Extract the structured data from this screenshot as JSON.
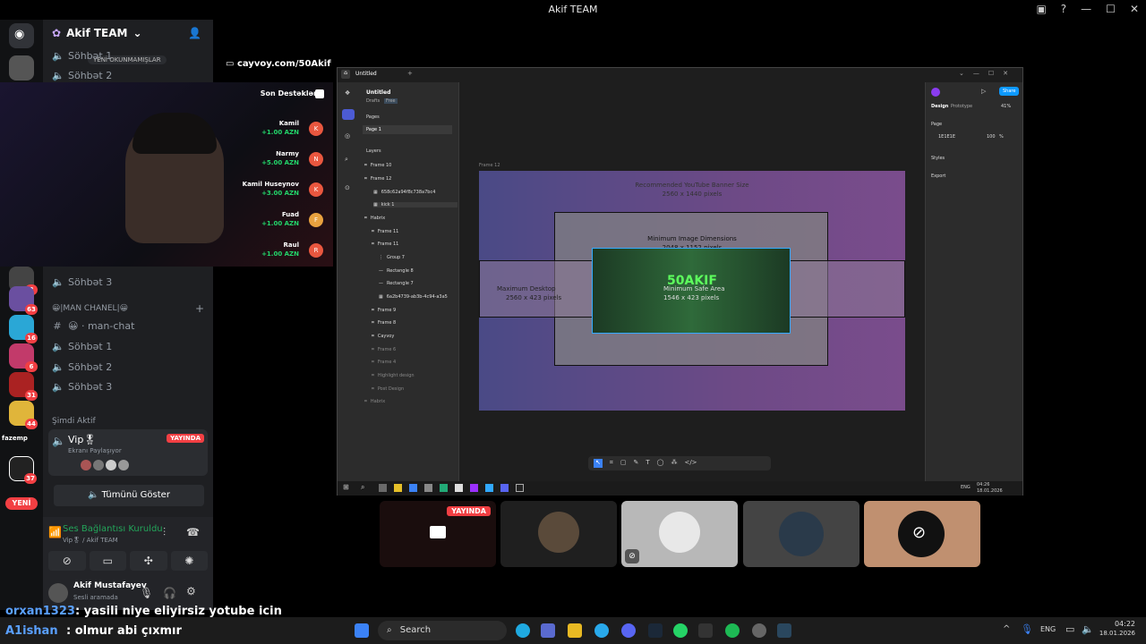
{
  "window": {
    "title": "Akif TEAM"
  },
  "server": {
    "name": "Akif TEAM",
    "new_unread": "YENİ OKUNMAMIŞLAR"
  },
  "channels_top": [
    "Söhbət 1",
    "Söhbət 2",
    "Söhbət 3"
  ],
  "category": {
    "name": "😀|MAN CHANEL|😀"
  },
  "channels_cat": {
    "text": "😀 · man-chat",
    "voice": [
      "Söhbət 1",
      "Söhbət 2",
      "Söhbət 3"
    ]
  },
  "active": {
    "heading": "Şimdi Aktif",
    "channel": "Vip🎖",
    "sub": "Ekranı Paylaşıyor",
    "live": "YAYINDA",
    "show_all": "Tümünü Göster"
  },
  "voice_status": {
    "title": "Ses Bağlantısı Kuruldu",
    "sub": "Vip🎖 / Akif TEAM"
  },
  "user": {
    "name": "Akif Mustafayev",
    "status": "Sesli aramada"
  },
  "rail_badges": [
    "3",
    "63",
    "16",
    "6",
    "31",
    "44",
    "37"
  ],
  "rail_new": "YENİ",
  "rail_label": "fazemp",
  "overlay": {
    "link": "cayvoy.com/50Akif",
    "donors_title": "Son Destəklər",
    "donors": [
      {
        "name": "Kamil",
        "amount": "+1.00 AZN"
      },
      {
        "name": "Narmy",
        "amount": "+5.00 AZN"
      },
      {
        "name": "Kamil Huseynov",
        "amount": "+3.00 AZN"
      },
      {
        "name": "Fuad",
        "amount": "+1.00 AZN"
      },
      {
        "name": "Raul",
        "amount": "+1.00 AZN"
      }
    ]
  },
  "figma": {
    "tab": "Untitled",
    "file": "Untitled",
    "drafts": "Drafts",
    "plan": "Free",
    "pages_label": "Pages",
    "page1": "Page 1",
    "layers_label": "Layers",
    "layers": [
      "Frame 10",
      "Frame 12",
      "658c62a94f8c738a7bc4",
      "kick 1",
      "Habrix",
      "Frame 11",
      "Frame 11",
      "Group 7",
      "Rectangle 8",
      "Rectangle 7",
      "6a2b4739-ab3b-4c94-a3a5",
      "Frame 9",
      "Frame 8",
      "Cayvoy",
      "Frame 6",
      "Frame 4",
      "Highlight design",
      "Post Design",
      "Habrix"
    ],
    "frame_label": "Frame 12",
    "banner": {
      "rec_title": "Recommended YouTube Banner Size",
      "rec_size": "2560 x 1440 pixels",
      "min_img": "Minimum Image Dimensions",
      "min_img_size": "2048 x 1152 pixels",
      "max_desk": "Maximum Desktop",
      "max_desk_size": "2560 x 423 pixels",
      "safe": "Minimum Safe Area",
      "safe_size": "1546 x 423 pixels",
      "brand": "50AKIF"
    },
    "right": {
      "design": "Design",
      "prototype": "Prototype",
      "zoom": "41%",
      "page": "Page",
      "color": "1E1E1E",
      "opacity": "100",
      "pct": "%",
      "styles": "Styles",
      "export": "Export",
      "share": "Share"
    },
    "clock": "04:26",
    "date": "18.01.2026",
    "lang": "ENG"
  },
  "tiles": {
    "live": "YAYINDA"
  },
  "chat": [
    {
      "user": "orxan1323",
      "msg": ": yasili niye eliyirsiz yotube icin"
    },
    {
      "user": "A1ishan",
      "msg": ": olmur abi çıxmır"
    }
  ],
  "taskbar": {
    "search": "Search",
    "lang": "ENG",
    "time": "04:22",
    "date": "18.01.2026"
  }
}
